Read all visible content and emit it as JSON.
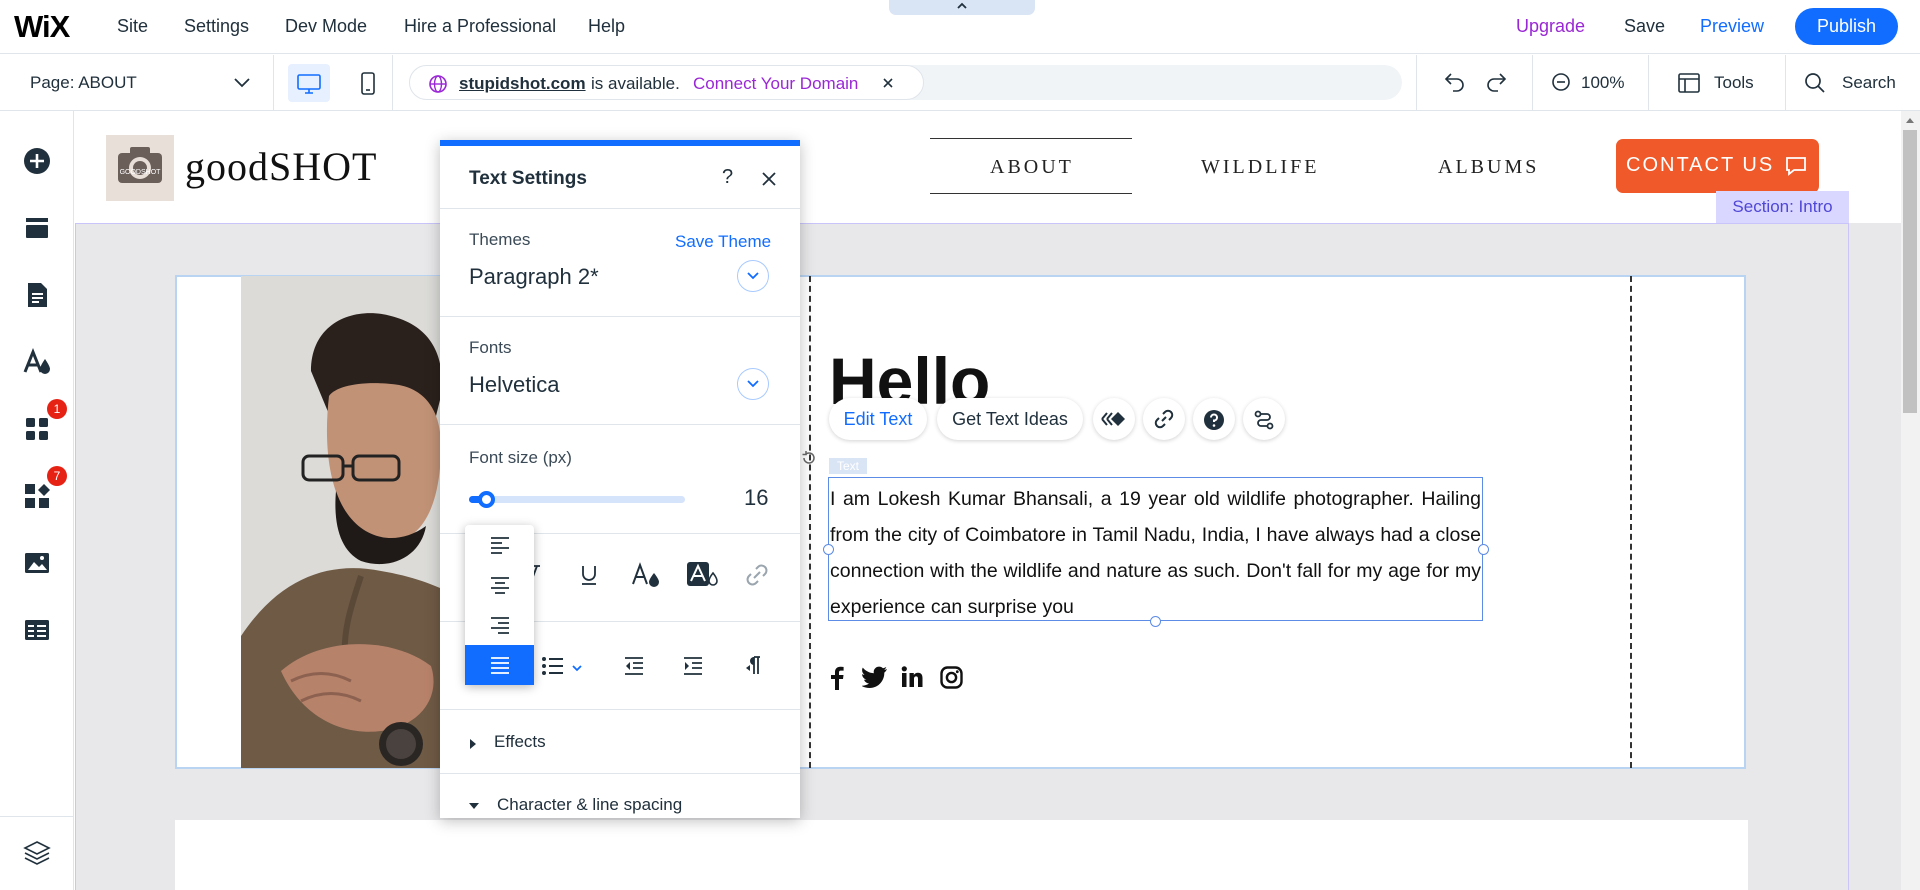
{
  "app": {
    "logo": "WiX",
    "menu": [
      "Site",
      "Settings",
      "Dev Mode",
      "Hire a Professional",
      "Help"
    ],
    "upgrade_label": "Upgrade",
    "save_label": "Save",
    "preview_label": "Preview",
    "publish_label": "Publish"
  },
  "toolbar": {
    "page_select": "Page: ABOUT",
    "domain_name": "stupidshot.com",
    "domain_status": "is available.",
    "connect_domain": "Connect Your Domain",
    "zoom": "100%",
    "tools_label": "Tools",
    "search_label": "Search"
  },
  "sidebar": {
    "items": [
      "add-icon",
      "sections-icon",
      "pages-icon",
      "design-icon",
      "apps-icon",
      "business-icon",
      "media-icon",
      "cms-icon"
    ],
    "badges": {
      "apps": "1",
      "business": "7"
    },
    "layers": "layers-icon"
  },
  "site": {
    "logo_text": "goodSHOT",
    "logo_image_text": "GOODSHOT",
    "nav": [
      "ABOUT",
      "WILDLIFE",
      "ALBUMS"
    ],
    "contact_label": "CONTACT US",
    "section_label": "Section: Intro",
    "heading": "Hello",
    "text_tag": "Text",
    "body": "I am Lokesh Kumar Bhansali, a 19 year old wildlife photographer. Hailing from the city of Coimbatore in Tamil Nadu, India, I have always had a close connection with the wildlife and nature as such. Don't fall for my age for my experience can surprise you",
    "social": [
      "facebook-icon",
      "twitter-icon",
      "linkedin-icon",
      "instagram-icon"
    ]
  },
  "float_toolbar": {
    "edit_text": "Edit Text",
    "get_text_ideas": "Get Text Ideas"
  },
  "text_settings": {
    "title": "Text Settings",
    "help": "?",
    "themes_label": "Themes",
    "save_theme": "Save Theme",
    "theme_value": "Paragraph 2*",
    "fonts_label": "Fonts",
    "font_value": "Helvetica",
    "font_size_label": "Font size (px)",
    "font_size_value": "16",
    "font_size_fraction": 0.08,
    "effects_label": "Effects",
    "char_spacing_label": "Character & line spacing",
    "align_options": [
      "align-left",
      "align-center",
      "align-right",
      "align-justify"
    ],
    "align_selected": "align-justify"
  },
  "colors": {
    "accent": "#116dff",
    "contact_button": "#f0592a",
    "section_label_bg": "#d9d6ff",
    "connect_domain": "#9a27d5",
    "badge": "#e62214"
  }
}
